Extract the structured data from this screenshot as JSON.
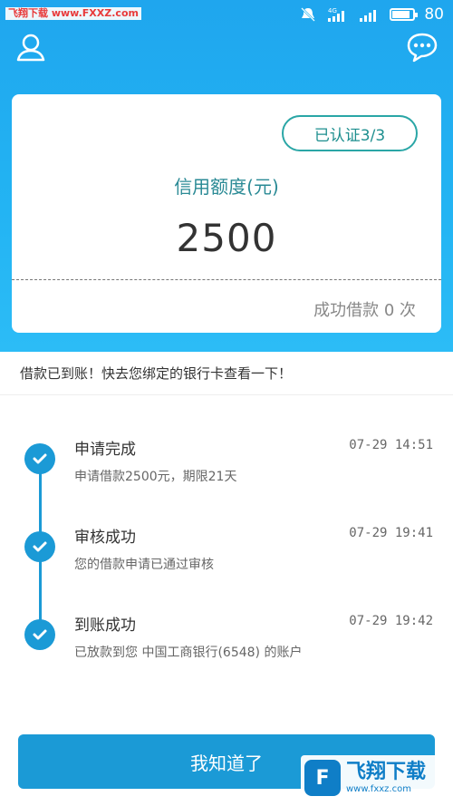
{
  "status_bar": {
    "watermark_text": "飞翔下载 www.FXXZ.com",
    "network": "4G",
    "battery": "80"
  },
  "header": {
    "user_icon": "user-icon",
    "message_icon": "chat-bubble-icon"
  },
  "card": {
    "verified_badge": "已认证3/3",
    "credit_label": "信用额度(元)",
    "credit_amount": "2500",
    "borrow_count": "成功借款 0 次"
  },
  "notice": "借款已到账！快去您绑定的银行卡查看一下！",
  "steps": [
    {
      "title": "申请完成",
      "time": "07-29 14:51",
      "desc": "申请借款2500元，期限21天"
    },
    {
      "title": "审核成功",
      "time": "07-29 19:41",
      "desc": "您的借款申请已通过审核"
    },
    {
      "title": "到账成功",
      "time": "07-29 19:42",
      "desc": "已放款到您 中国工商银行(6548) 的账户"
    }
  ],
  "button_label": "我知道了",
  "watermark_logo": {
    "big": "飞翔下载",
    "small": "www.fxxz.com"
  },
  "colors": {
    "primary": "#1b9ad6",
    "header": "#23b4f3",
    "badge": "#2aa6a6"
  }
}
